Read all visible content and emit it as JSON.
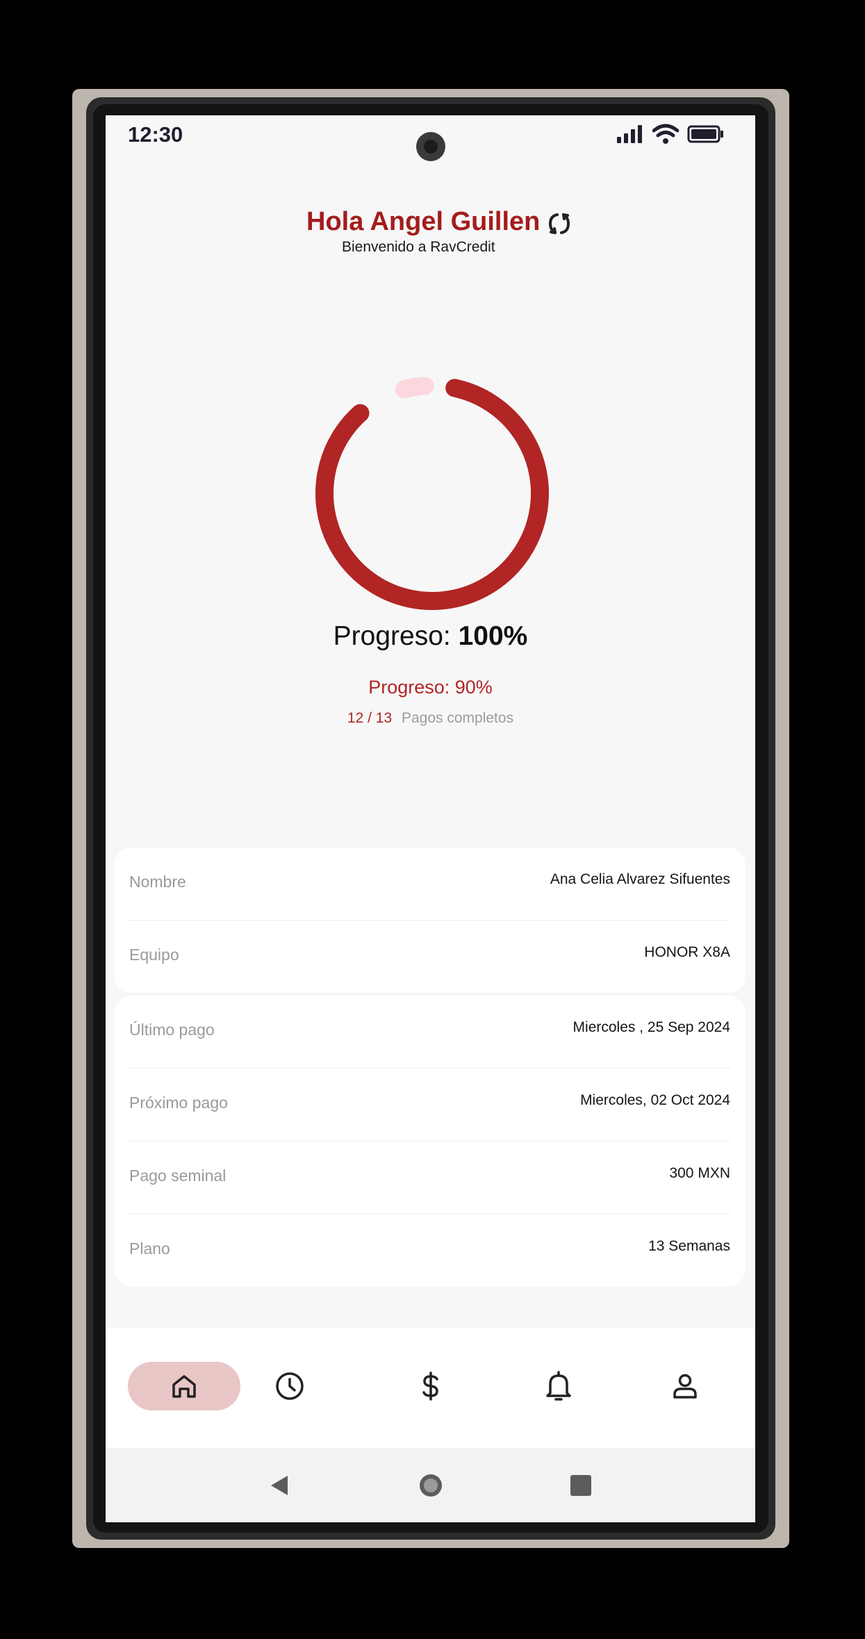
{
  "status": {
    "time": "12:30"
  },
  "header": {
    "greeting": "Hola Angel Guillen",
    "welcome": "Bienvenido a RavCredit"
  },
  "progress": {
    "label": "Progreso:",
    "main_value": "100%",
    "sub_label": "Progreso:",
    "sub_value": "90%",
    "paid_count": "12 / 13",
    "paid_label": "Pagos completos",
    "ring_fraction": 0.9
  },
  "client_card": {
    "rows": [
      {
        "label": "Nombre",
        "value": "Ana Celia Alvarez Sifuentes"
      },
      {
        "label": "Equipo",
        "value": "HONOR X8A"
      }
    ]
  },
  "payment_card": {
    "rows": [
      {
        "label": "Último pago",
        "value": "Miercoles , 25 Sep 2024"
      },
      {
        "label": "Próximo pago",
        "value": "Miercoles, 02 Oct 2024"
      },
      {
        "label": "Pago seminal",
        "value": "300 MXN"
      },
      {
        "label": "Plano",
        "value": "13 Semanas"
      }
    ]
  },
  "bottom_nav": {
    "items": [
      {
        "icon": "home-icon",
        "active": true
      },
      {
        "icon": "clock-icon",
        "active": false
      },
      {
        "icon": "dollar-icon",
        "active": false
      },
      {
        "icon": "bell-icon",
        "active": false
      },
      {
        "icon": "user-icon",
        "active": false
      }
    ]
  },
  "colors": {
    "accent": "#b12525",
    "ring_remaining": "#fcd8de",
    "nav_active_bg": "#e9c6c6"
  }
}
